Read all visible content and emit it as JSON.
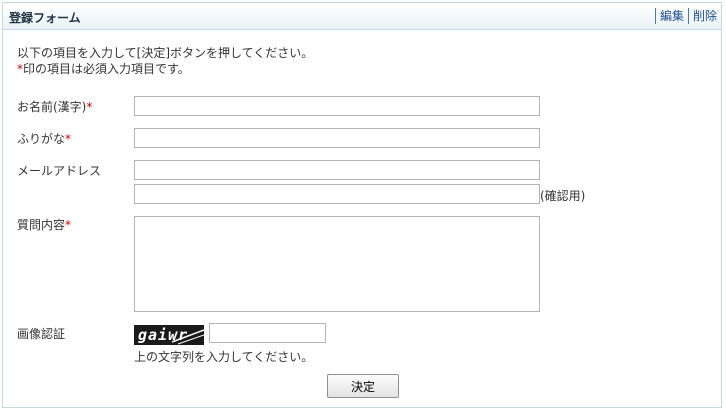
{
  "header": {
    "title": "登録フォーム",
    "edit_label": "編集",
    "delete_label": "削除"
  },
  "intro": {
    "line1": "以下の項目を入力して[決定]ボタンを押してください。",
    "line2_mark": "*",
    "line2_text": "印の項目は必須入力項目です。"
  },
  "fields": {
    "name_kanji": {
      "label": "お名前(漢字)",
      "required_mark": "*",
      "value": ""
    },
    "furigana": {
      "label": "ふりがな",
      "required_mark": "*",
      "value": ""
    },
    "email": {
      "label": "メールアドレス",
      "value": "",
      "confirm_value": "",
      "confirm_label": "(確認用)"
    },
    "question": {
      "label": "質問内容",
      "required_mark": "*",
      "value": ""
    },
    "captcha": {
      "label": "画像認証",
      "image_text": "gaiwr",
      "value": "",
      "hint": "上の文字列を入力してください。"
    }
  },
  "submit": {
    "label": "決定"
  },
  "colors": {
    "required": "#cc0000",
    "link": "#1e4f8e",
    "border": "#c6d9e2"
  },
  "icons": {
    "captcha": "captcha-image"
  }
}
